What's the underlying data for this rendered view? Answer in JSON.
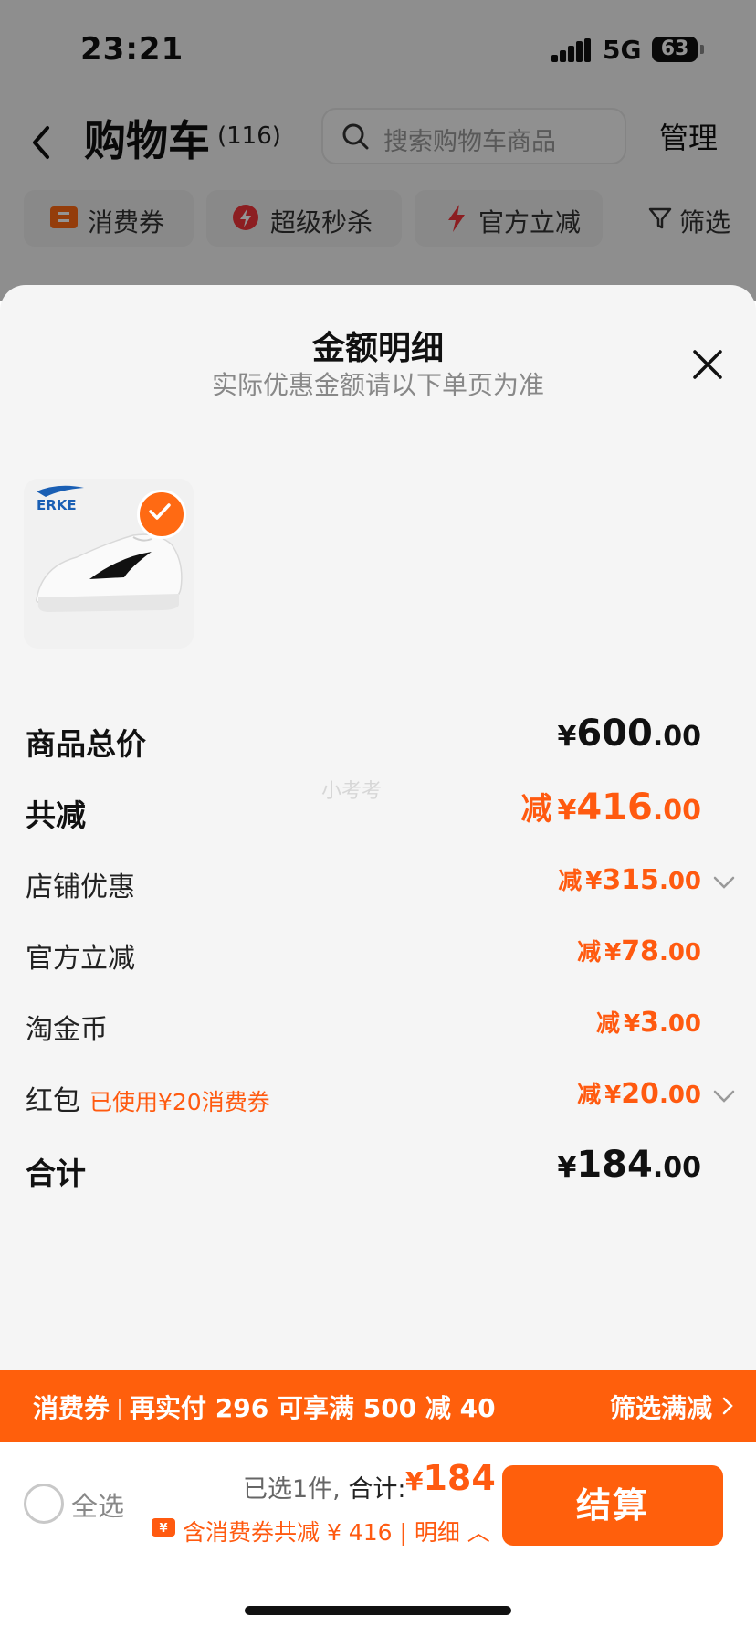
{
  "status_bar": {
    "time": "23:21",
    "network": "5G",
    "battery": "63"
  },
  "nav": {
    "title": "购物车",
    "count": "(116)",
    "search_placeholder": "搜索购物车商品",
    "manage": "管理"
  },
  "filters": [
    {
      "label": "消费券",
      "icon": "coupon-icon"
    },
    {
      "label": "超级秒杀",
      "icon": "flash-icon"
    },
    {
      "label": "官方立减",
      "icon": "bolt-icon"
    },
    {
      "label": "筛选",
      "icon": "filter-icon"
    }
  ],
  "sheet": {
    "title": "金额明细",
    "subtitle": "实际优惠金额请以下单页为准",
    "product": {
      "brand": "ERKE"
    },
    "watermark": "小考考",
    "rows": {
      "subtotal": {
        "label": "商品总价",
        "prefix": "",
        "yen": "¥",
        "int": "600",
        "dec": ".00"
      },
      "total_discount": {
        "label": "共减",
        "prefix": "减",
        "yen": "¥",
        "int": "416",
        "dec": ".00"
      },
      "shop_discount": {
        "label": "店铺优惠",
        "prefix": "减",
        "yen": "¥",
        "int": "315",
        "dec": ".00"
      },
      "official_discount": {
        "label": "官方立减",
        "prefix": "减",
        "yen": "¥",
        "int": "78",
        "dec": ".00"
      },
      "taojinbi": {
        "label": "淘金币",
        "prefix": "减",
        "yen": "¥",
        "int": "3",
        "dec": ".00"
      },
      "red_packet": {
        "label": "红包",
        "note": "已使用¥20消费券",
        "prefix": "减",
        "yen": "¥",
        "int": "20",
        "dec": ".00"
      },
      "total": {
        "label": "合计",
        "prefix": "",
        "yen": "¥",
        "int": "184",
        "dec": ".00"
      }
    }
  },
  "promo": {
    "tag": "消费券",
    "text": "再实付 296 可享满 500 减 40",
    "action": "筛选满减"
  },
  "checkout": {
    "select_all": "全选",
    "selected": "已选1件,",
    "total_label": "合计:",
    "yen": "¥",
    "total": "184",
    "discount_text": "含消费券共减 ¥ 416 | 明细",
    "button": "结算"
  },
  "colors": {
    "accent": "#ff5f0c",
    "discount_text": "#ff5a10"
  }
}
